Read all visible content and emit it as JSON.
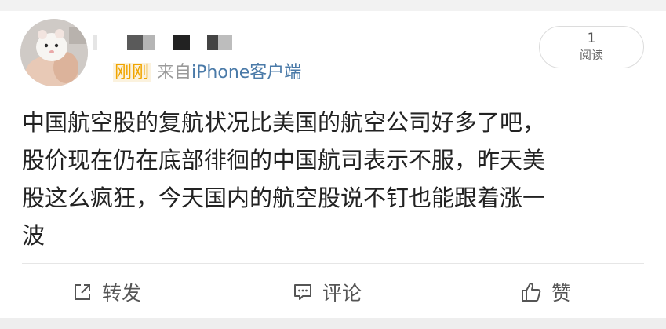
{
  "post": {
    "time_label": "刚刚",
    "source_prefix": "来自",
    "source_client": "iPhone客户端",
    "read_count": "1",
    "read_label": "阅读",
    "content_lines": [
      "中国航空股的复航状况比美国的航空公司好多了吧，",
      "股价现在仍在底部徘徊的中国航司表示不服，昨天美",
      "股这么疯狂，今天国内的航空股说不钉也能跟着涨一",
      "波"
    ]
  },
  "actions": {
    "repost_label": "转发",
    "comment_label": "评论",
    "like_label": "赞"
  },
  "icons": {
    "repost": "share-icon",
    "comment": "comment-icon",
    "like": "thumbs-up-icon"
  },
  "colors": {
    "time": "#f0a500",
    "client": "#4a7aa8",
    "text": "#222222",
    "muted": "#9a9a9a"
  }
}
